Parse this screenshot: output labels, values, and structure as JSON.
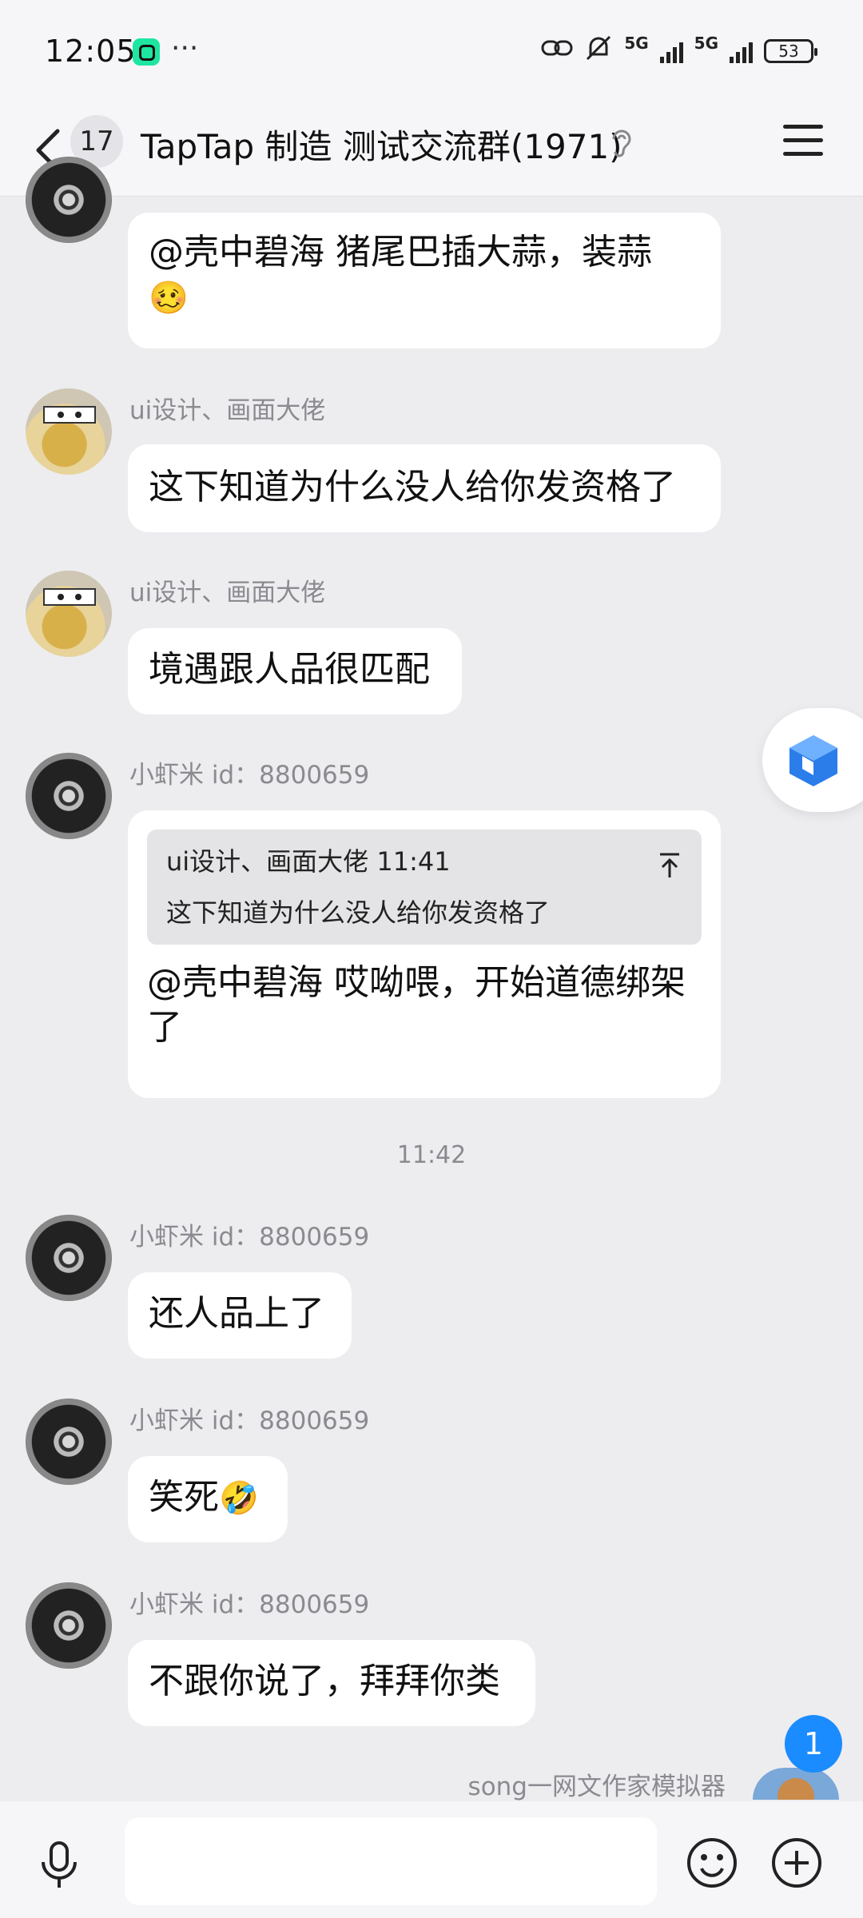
{
  "status_bar": {
    "time": "12:05",
    "dots": "···",
    "net1": "5G",
    "net2": "5G",
    "battery": "53"
  },
  "header": {
    "back_count": "17",
    "title": "TapTap 制造 测试交流群(1971)"
  },
  "messages": [
    {
      "sender": "",
      "text": "@壳中碧海 猪尾巴插大蒜，装蒜",
      "emoji": "🥴"
    },
    {
      "sender": "ui设计、画面大佬",
      "text": "这下知道为什么没人给你发资格了"
    },
    {
      "sender": "ui设计、画面大佬",
      "text": "境遇跟人品很匹配"
    },
    {
      "sender": "小虾米 id：8800659",
      "quote_head": "ui设计、画面大佬 11:41",
      "quote_text": "这下知道为什么没人给你发资格了",
      "text": "@壳中碧海 哎呦喂，开始道德绑架了"
    },
    {
      "sender": "小虾米 id：8800659",
      "text": "还人品上了"
    },
    {
      "sender": "小虾米 id：8800659",
      "text": "笑死",
      "emoji": "🤣"
    },
    {
      "sender": "小虾米 id：8800659",
      "text": "不跟你说了，拜拜你类"
    }
  ],
  "time_separator": "11:42",
  "bottom_preview": {
    "sender": "song一网文作家模拟器",
    "unread": "1"
  },
  "input": {
    "placeholder": ""
  },
  "icons": {
    "back": "chevron-left-icon",
    "ear": "ear-icon",
    "menu": "hamburger-menu-icon",
    "mic": "microphone-icon",
    "smile": "emoji-icon",
    "plus": "plus-icon"
  },
  "colors": {
    "background": "#ededf0",
    "bubble": "#ffffff",
    "badge": "#1a8cff"
  }
}
